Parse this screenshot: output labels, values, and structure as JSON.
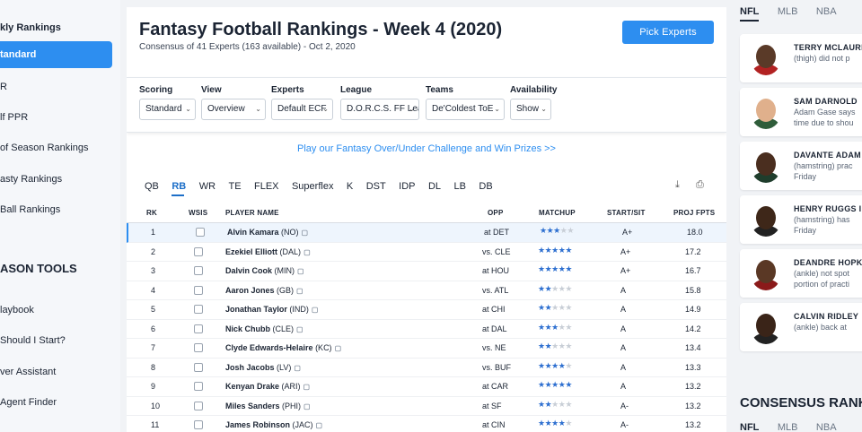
{
  "sidebar": {
    "heading": "kly Rankings",
    "active_item": "tandard",
    "items": [
      "R",
      "lf PPR",
      "of Season Rankings",
      "asty Rankings",
      "Ball Rankings"
    ],
    "tools_heading": "ASON TOOLS",
    "tools": [
      "laybook",
      "Should I Start?",
      "ver Assistant",
      "Agent Finder"
    ]
  },
  "header": {
    "title": "Fantasy Football Rankings - Week 4 (2020)",
    "subtitle": "Consensus of 41 Experts (163 available) - Oct 2, 2020",
    "pick_experts_label": "Pick Experts"
  },
  "filters": [
    {
      "label": "Scoring",
      "value": "Standard"
    },
    {
      "label": "View",
      "value": "Overview"
    },
    {
      "label": "Experts",
      "value": "Default ECF"
    },
    {
      "label": "League",
      "value": "D.O.R.C.S. FF Lea"
    },
    {
      "label": "Teams",
      "value": "De'Coldest ToE"
    },
    {
      "label": "Availability",
      "value": "Show"
    }
  ],
  "promo": "Play our Fantasy Over/Under Challenge and Win Prizes >>",
  "position_tabs": [
    "QB",
    "RB",
    "WR",
    "TE",
    "FLEX",
    "Superflex",
    "K",
    "DST",
    "IDP",
    "DL",
    "LB",
    "DB"
  ],
  "active_position": "RB",
  "table": {
    "headers": {
      "rk": "RK",
      "wsis": "WSIS",
      "player": "PLAYER NAME",
      "opp": "OPP",
      "matchup": "MATCHUP",
      "start_sit": "START/SIT",
      "proj": "PROJ FPTS"
    },
    "rows": [
      {
        "rk": "1",
        "name": "Alvin Kamara",
        "team": "(NO)",
        "opp": "at DET",
        "stars": 3,
        "grade": "A+",
        "proj": "18.0"
      },
      {
        "rk": "2",
        "name": "Ezekiel Elliott",
        "team": "(DAL)",
        "opp": "vs. CLE",
        "stars": 5,
        "grade": "A+",
        "proj": "17.2"
      },
      {
        "rk": "3",
        "name": "Dalvin Cook",
        "team": "(MIN)",
        "opp": "at HOU",
        "stars": 5,
        "grade": "A+",
        "proj": "16.7"
      },
      {
        "rk": "4",
        "name": "Aaron Jones",
        "team": "(GB)",
        "opp": "vs. ATL",
        "stars": 2,
        "grade": "A",
        "proj": "15.8"
      },
      {
        "rk": "5",
        "name": "Jonathan Taylor",
        "team": "(IND)",
        "opp": "at CHI",
        "stars": 2,
        "grade": "A",
        "proj": "14.9"
      },
      {
        "rk": "6",
        "name": "Nick Chubb",
        "team": "(CLE)",
        "opp": "at DAL",
        "stars": 3,
        "grade": "A",
        "proj": "14.2"
      },
      {
        "rk": "7",
        "name": "Clyde Edwards-Helaire",
        "team": "(KC)",
        "opp": "vs. NE",
        "stars": 2,
        "grade": "A",
        "proj": "13.4"
      },
      {
        "rk": "8",
        "name": "Josh Jacobs",
        "team": "(LV)",
        "opp": "vs. BUF",
        "stars": 4,
        "grade": "A",
        "proj": "13.3"
      },
      {
        "rk": "9",
        "name": "Kenyan Drake",
        "team": "(ARI)",
        "opp": "at CAR",
        "stars": 5,
        "grade": "A",
        "proj": "13.2"
      },
      {
        "rk": "10",
        "name": "Miles Sanders",
        "team": "(PHI)",
        "opp": "at SF",
        "stars": 2,
        "grade": "A-",
        "proj": "13.2"
      },
      {
        "rk": "11",
        "name": "James Robinson",
        "team": "(JAC)",
        "opp": "at CIN",
        "stars": 4,
        "grade": "A-",
        "proj": "13.2"
      }
    ]
  },
  "right_panel": {
    "sport_tabs": [
      "NFL",
      "MLB",
      "NBA"
    ],
    "news": [
      {
        "name": "TERRY MCLAURI",
        "line1": "(thigh) did not p",
        "line2": "",
        "skin": "#5a3a28",
        "jersey": "#b22222"
      },
      {
        "name": "SAM DARNOLD",
        "line1": "Adam Gase says",
        "line2": "time due to shou",
        "skin": "#e0b08c",
        "jersey": "#2f5d3a"
      },
      {
        "name": "DAVANTE ADAM",
        "line1": "(hamstring) prac",
        "line2": "Friday",
        "skin": "#4a2e1f",
        "jersey": "#1f3d2c"
      },
      {
        "name": "HENRY RUGGS I",
        "line1": "(hamstring) has",
        "line2": "Friday",
        "skin": "#3e2719",
        "jersey": "#222"
      },
      {
        "name": "DEANDRE HOPK",
        "line1": "(ankle) not spot",
        "line2": "portion of practi",
        "skin": "#5a3825",
        "jersey": "#8b1a1a"
      },
      {
        "name": "CALVIN RIDLEY",
        "line1": "(ankle) back at",
        "line2": "",
        "skin": "#3a2418",
        "jersey": "#222"
      }
    ],
    "consensus_title": "CONSENSUS RANK",
    "sport_tabs_2": [
      "NFL",
      "MLB",
      "NBA"
    ]
  },
  "colors": {
    "accent": "#2d8ef0",
    "star_filled": "#2d6fd0",
    "star_empty": "#c8ced6"
  }
}
